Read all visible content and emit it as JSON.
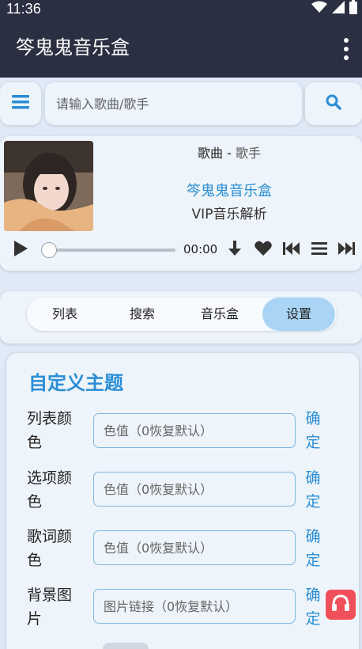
{
  "status_bar": {
    "time": "11:36"
  },
  "app_bar": {
    "title": "笒鬼鬼音乐盒"
  },
  "search": {
    "placeholder": "请输入歌曲/歌手"
  },
  "player": {
    "song": "歌曲",
    "separator": " - ",
    "artist": "歌手",
    "brand": "笒鬼鬼音乐盒",
    "subtitle": "VIP音乐解析",
    "time": "00:00",
    "progress": 0
  },
  "tabs": [
    {
      "label": "列表",
      "active": false
    },
    {
      "label": "搜索",
      "active": false
    },
    {
      "label": "音乐盒",
      "active": false
    },
    {
      "label": "设置",
      "active": true
    }
  ],
  "theme": {
    "title": "自定义主题",
    "rows": [
      {
        "label": "列表颜色",
        "placeholder": "色值（0恢复默认）",
        "confirm": "确定"
      },
      {
        "label": "选项颜色",
        "placeholder": "色值（0恢复默认）",
        "confirm": "确定"
      },
      {
        "label": "歌词颜色",
        "placeholder": "色值（0恢复默认）",
        "confirm": "确定"
      },
      {
        "label": "背景图片",
        "placeholder": "图片链接（0恢复默认）",
        "confirm": "确定"
      }
    ]
  },
  "colors": {
    "app_bar": "#2b2f42",
    "accent": "#2a8ed6",
    "active_tab": "#a9d4f5",
    "fab": "#f0505a"
  },
  "icons": [
    "wifi-icon",
    "signal-icon",
    "battery-icon",
    "menu-icon",
    "search-icon",
    "play-icon",
    "download-icon",
    "heart-icon",
    "previous-icon",
    "playlist-icon",
    "next-icon",
    "headphones-icon"
  ]
}
